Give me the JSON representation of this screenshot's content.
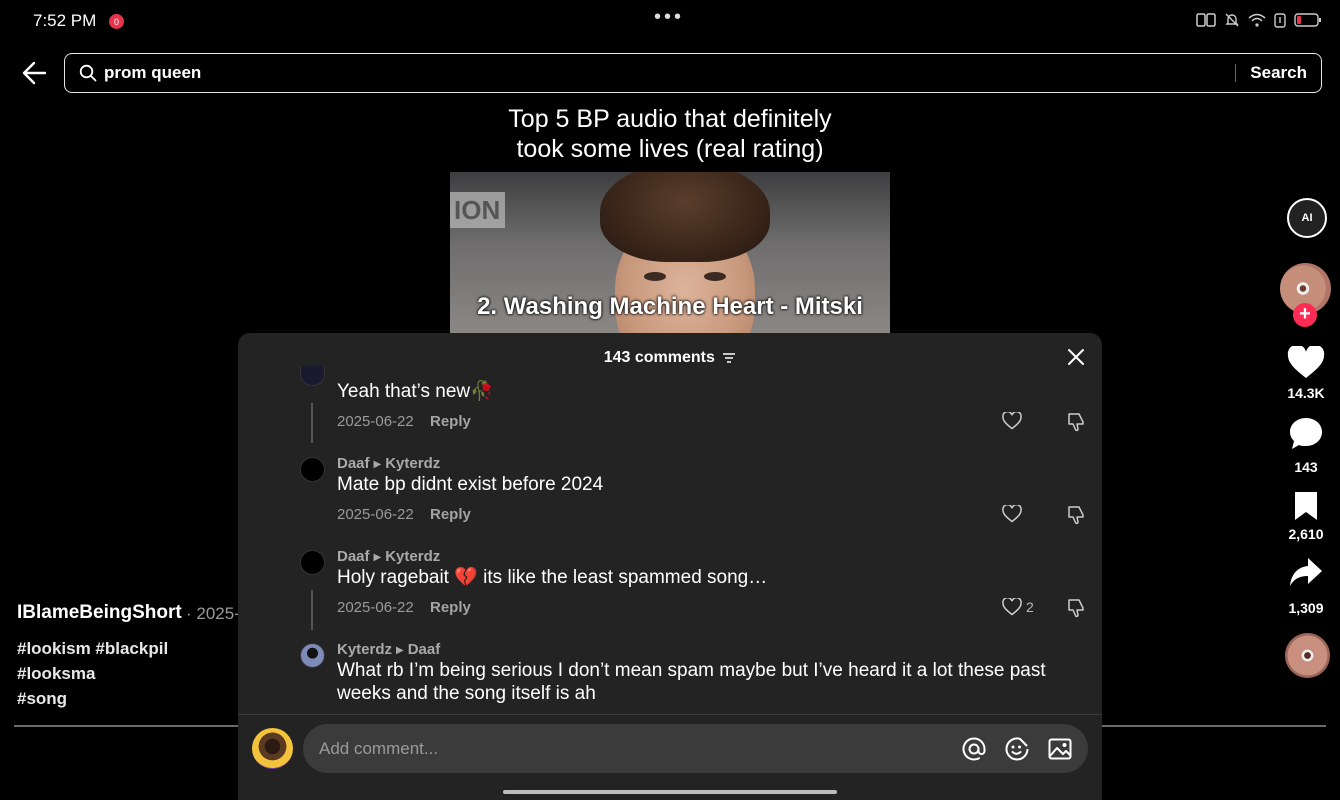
{
  "status_bar": {
    "time": "7:52 PM",
    "record_badge": "0"
  },
  "search": {
    "value": "prom queen",
    "submit_label": "Search"
  },
  "video": {
    "caption_line1": "Top 5 BP audio that definitely",
    "caption_line2": "took some lives (real rating)",
    "logo_text": "ION",
    "subtitle": "2. Washing Machine Heart - Mitski"
  },
  "post": {
    "author": "IBlameBeingShort",
    "date": "· 2025-",
    "hashtags_line1": "#lookism #blackpil #looksma",
    "hashtags_line2": "#song"
  },
  "rail": {
    "ai_label": "AI",
    "likes": "14.3K",
    "comments": "143",
    "saves": "2,610",
    "shares": "1,309"
  },
  "comments_panel": {
    "title": "143 comments",
    "items": [
      {
        "text": "Yeah that’s new🥀",
        "date": "2025-06-22",
        "reply_label": "Reply",
        "likes": ""
      },
      {
        "author": "Daaf",
        "reply_to": "Kyterdz",
        "text": "Mate bp didnt exist before 2024",
        "date": "2025-06-22",
        "reply_label": "Reply",
        "likes": ""
      },
      {
        "author": "Daaf",
        "reply_to": "Kyterdz",
        "text": "Holy ragebait 💔 its like the least spammed song…",
        "date": "2025-06-22",
        "reply_label": "Reply",
        "likes": "2"
      },
      {
        "author": "Kyterdz",
        "reply_to": "Daaf",
        "text": "What rb I’m being serious I don’t mean spam maybe but I’ve heard it a lot these past weeks and the song itself is ah"
      }
    ],
    "composer_placeholder": "Add comment..."
  },
  "colors": {
    "background": "#000000",
    "panel": "#232323",
    "accent": "#fe2c55"
  }
}
